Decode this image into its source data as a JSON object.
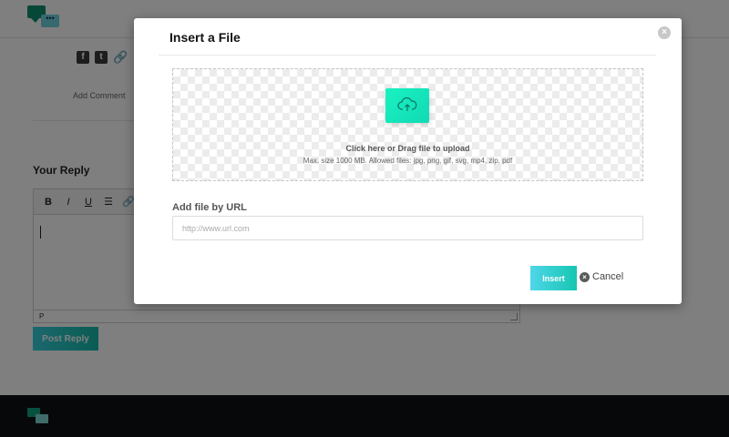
{
  "page": {
    "add_comment": "Add Comment",
    "reply_title": "Your Reply",
    "editor": {
      "toolbar": [
        "B",
        "I",
        "U",
        "☰",
        "🔗"
      ],
      "status_path": "P"
    },
    "post_reply_label": "Post Reply",
    "logo_glyph": "•••"
  },
  "modal": {
    "title": "Insert a File",
    "close_glyph": "×",
    "dropzone": {
      "main_text": "Click here or Drag file to upload",
      "sub_text": "Max. size 1000 MB. Allowed files: jpg, png, gif, svg, mp4, zip, pdf"
    },
    "url": {
      "label": "Add file by URL",
      "placeholder": "http://www.url.com",
      "value": ""
    },
    "insert_label": "Insert",
    "cancel_label": "Cancel",
    "cancel_glyph": "×"
  },
  "icons": {
    "share": [
      "facebook-icon",
      "twitter-icon",
      "link-icon"
    ],
    "upload": "cloud-upload-icon"
  },
  "colors": {
    "accent_start": "#36d1dc",
    "accent_end": "#14b8a6",
    "upload_icon": "#19f2c0",
    "footer": "#0f1115"
  }
}
